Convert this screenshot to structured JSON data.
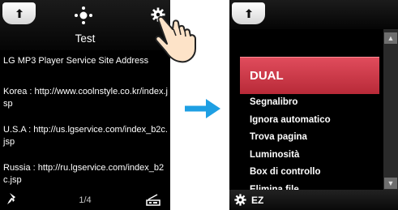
{
  "left_screen": {
    "title": "Test",
    "heading": "LG MP3 Player Service Site Address",
    "entries": [
      "Korea : http://www.coolnstyle.co.kr/index.jsp",
      "U.S.A : http://us.lgservice.com/index_b2c.jsp",
      "Russia : http://ru.lgservice.com/index_b2c.jsp"
    ],
    "page_indicator": "1/4",
    "icons": {
      "back": "back-arrow-icon",
      "navigation": "dpad-icon",
      "settings": "gear-icon",
      "pin": "pin-icon",
      "equalizer": "equalizer-icon"
    }
  },
  "right_screen": {
    "selected_item": "DUAL",
    "menu_items": [
      "Segnalibro",
      "Ignora automatico",
      "Trova pagina",
      "Luminosità",
      "Box di controllo",
      "Elimina file"
    ],
    "bottom_label": "EZ",
    "icons": {
      "back": "back-arrow-icon",
      "settings": "gear-icon",
      "scroll_up": "chevron-up-icon",
      "scroll_down": "chevron-down-icon"
    }
  },
  "colors": {
    "accent": "#c8323f",
    "arrow": "#1e9fe3",
    "background": "#000000"
  }
}
